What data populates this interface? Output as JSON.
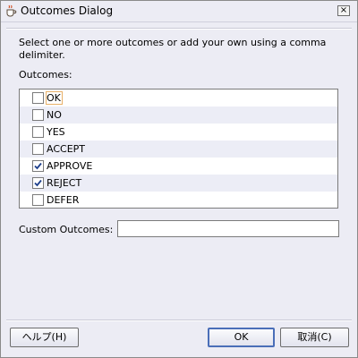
{
  "window": {
    "title": "Outcomes Dialog",
    "close_glyph": "×"
  },
  "instruction": "Select one or more outcomes or add your own using a comma delimiter.",
  "outcomes_label": "Outcomes:",
  "outcomes": [
    {
      "label": "OK",
      "checked": false,
      "focused": true
    },
    {
      "label": "NO",
      "checked": false
    },
    {
      "label": "YES",
      "checked": false
    },
    {
      "label": "ACCEPT",
      "checked": false
    },
    {
      "label": "APPROVE",
      "checked": true
    },
    {
      "label": "REJECT",
      "checked": true
    },
    {
      "label": "DEFER",
      "checked": false
    }
  ],
  "custom": {
    "label": "Custom Outcomes:",
    "value": ""
  },
  "buttons": {
    "help": "ヘルプ(H)",
    "ok": "OK",
    "cancel": "取消(C)"
  },
  "colors": {
    "dialog_bg": "#ececf4",
    "alt_row": "#ecedf6",
    "check_color": "#1e3f8c",
    "focus_border": "#e8b067",
    "default_button_border": "#4a6eb8"
  },
  "icons": {
    "title": "java-cup-icon",
    "check": "checkmark-icon"
  }
}
